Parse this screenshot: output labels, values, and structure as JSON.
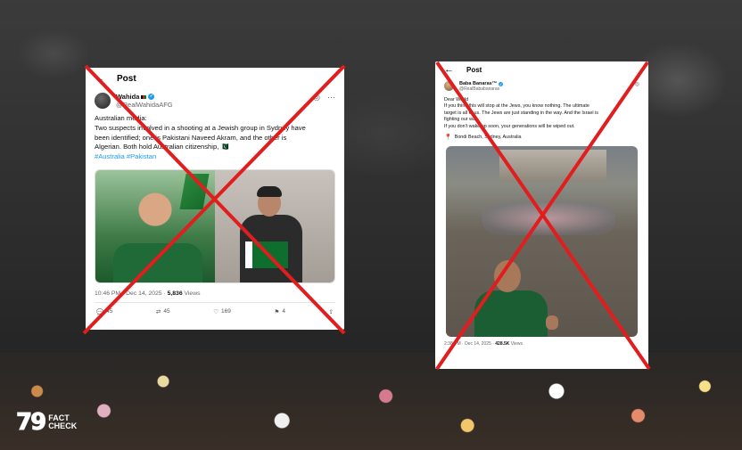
{
  "card1": {
    "topbar_title": "Post",
    "back_icon": "arrow-left-icon",
    "display_name": "Wahida",
    "handle": "@RealWahidaAFG",
    "text_lines": [
      "Australian media:",
      "Two suspects involved in a shooting at a Jewish group in Sydney have",
      "been identified; one is Pakistani Naveed Akram, and the other is",
      "Algerian. Both hold Australian citizenship, 🇵🇰"
    ],
    "hashtags": "#Australia #Pakistan",
    "time": "10:46 PM · Dec 14, 2025 · ",
    "views_count": "5,836",
    "views_label": " Views",
    "replies": "45",
    "reposts": "45",
    "likes": "169",
    "bookmarks": "4"
  },
  "card2": {
    "topbar_title": "Post",
    "display_name": "Baba Banaras™",
    "handle": "@RealBababanaras",
    "text_lines": [
      "Dear World",
      "If you think this will stop at the Jews, you know nothing. The ultimate",
      "target is all of us. The Jews are just standing in the way. And the Israel is",
      "fighting our war.",
      "If you don't wake up soon, your generations will be wiped out."
    ],
    "location": "Bondi Beach, Sydney, Australia",
    "time": "2:38 PM · Dec 14, 2025 · ",
    "views_count": "428.5K",
    "views_label": " Views"
  },
  "logo": {
    "number": "79",
    "line1": "FACT",
    "line2": "CHECK"
  },
  "colors": {
    "cross": "#e11d1d",
    "link": "#1d9bf0"
  }
}
